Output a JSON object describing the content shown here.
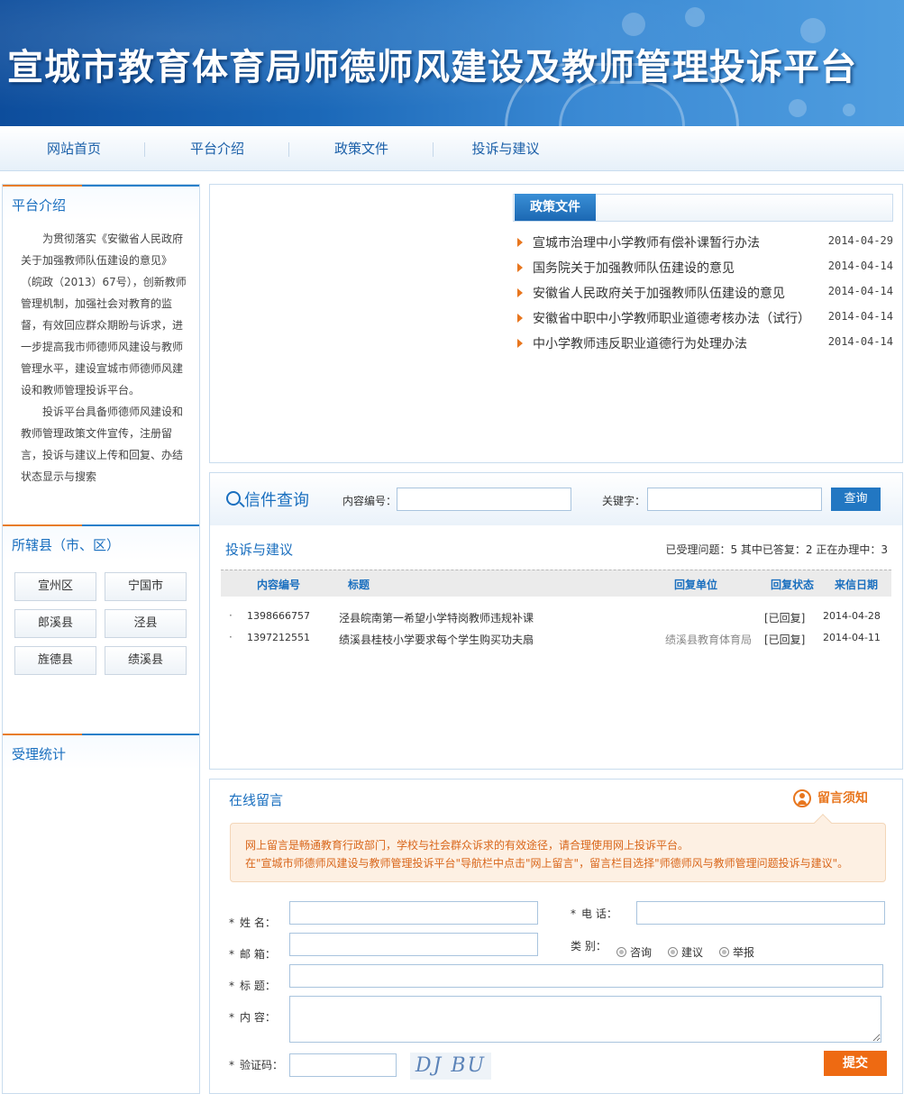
{
  "banner": {
    "title": "宣城市教育体育局师德师风建设及教师管理投诉平台"
  },
  "nav": {
    "items": [
      "网站首页",
      "平台介绍",
      "政策文件",
      "投诉与建议"
    ]
  },
  "intro": {
    "title": "平台介绍",
    "paragraphs": [
      "为贯彻落实《安徽省人民政府关于加强教师队伍建设的意见》（皖政（2013）67号），创新教师管理机制，加强社会对教育的监督，有效回应群众期盼与诉求，进一步提高我市师德师风建设与教师管理水平，建设宣城市师德师风建设和教师管理投诉平台。",
      "投诉平台具备师德师风建设和教师管理政策文件宣传，注册留言，投诉与建议上传和回复、办结状态显示与搜索"
    ]
  },
  "counties": {
    "title": "所辖县（市、区）",
    "items": [
      "宣州区",
      "宁国市",
      "郎溪县",
      "泾县",
      "旌德县",
      "绩溪县"
    ]
  },
  "stats_panel": {
    "title": "受理统计"
  },
  "policy": {
    "tab_label": "政策文件",
    "items": [
      {
        "title": "宣城市治理中小学教师有偿补课暂行办法",
        "date": "2014-04-29"
      },
      {
        "title": "国务院关于加强教师队伍建设的意见",
        "date": "2014-04-14"
      },
      {
        "title": "安徽省人民政府关于加强教师队伍建设的意见",
        "date": "2014-04-14"
      },
      {
        "title": "安徽省中职中小学教师职业道德考核办法（试行）",
        "date": "2014-04-14"
      },
      {
        "title": "中小学教师违反职业道德行为处理办法",
        "date": "2014-04-14"
      }
    ]
  },
  "query": {
    "title": "信件查询",
    "code_label": "内容编号：",
    "code_value": "",
    "keyword_label": "关键字：",
    "keyword_value": "",
    "button": "查询"
  },
  "complaints": {
    "title": "投诉与建议",
    "stats": "已受理问题：5 其中已答复：2 正在办理中：3",
    "columns": [
      "内容编号",
      "标题",
      "回复单位",
      "回复状态",
      "来信日期"
    ],
    "rows": [
      {
        "bullet": "·",
        "code": "1398666757",
        "title": "泾县皖南第一希望小学特岗教师违规补课",
        "unit": "",
        "status": "[已回复]",
        "date": "2014-04-28"
      },
      {
        "bullet": "·",
        "code": "1397212551",
        "title": "绩溪县桂枝小学要求每个学生购买功夫扇",
        "unit": "绩溪县教育体育局",
        "status": "[已回复]",
        "date": "2014-04-11"
      }
    ]
  },
  "message": {
    "title": "在线留言",
    "notice_link": "留言须知",
    "notice_lines": [
      "网上留言是畅通教育行政部门，学校与社会群众诉求的有效途径，请合理使用网上投诉平台。",
      "在\"宣城市师德师风建设与教师管理投诉平台\"导航栏中点击\"网上留言\"，留言栏目选择\"师德师风与教师管理问题投诉与建议\"。"
    ],
    "required_mark": "*",
    "labels": {
      "name": "姓  名：",
      "phone": "电  话：",
      "email": "邮  箱：",
      "category": "类  别：",
      "subject": "标  题：",
      "content": "内  容：",
      "captcha": "验证码："
    },
    "category_options": [
      "咨询",
      "建议",
      "举报"
    ],
    "captcha_text": "DJ BU",
    "submit": "提交"
  }
}
